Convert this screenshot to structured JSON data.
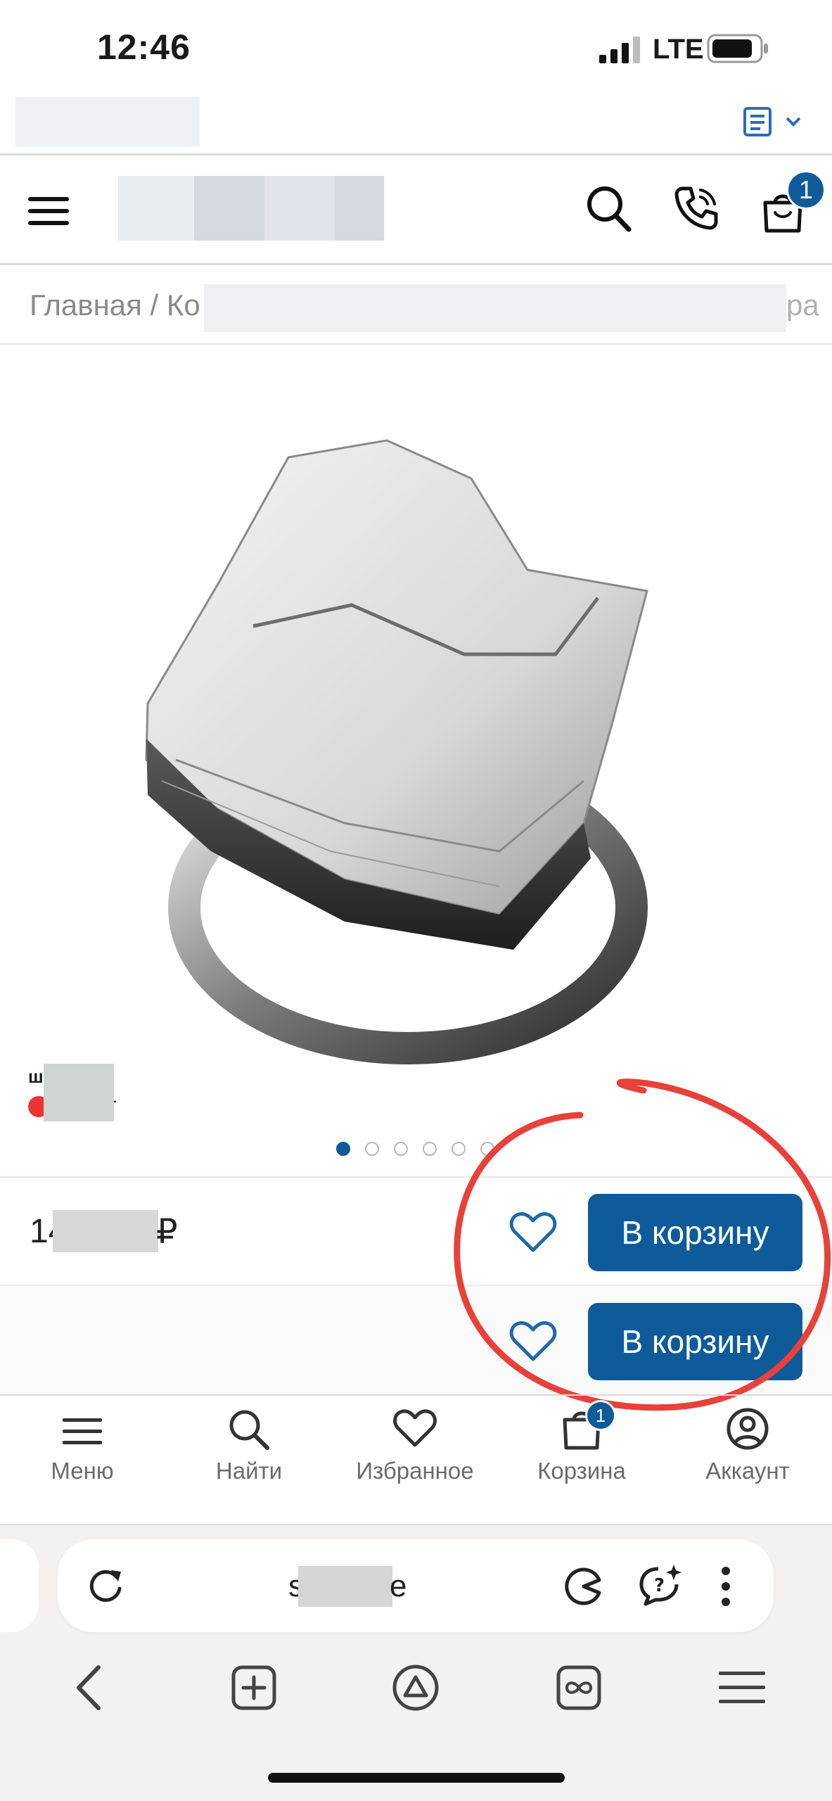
{
  "status_bar": {
    "time": "12:46",
    "network": "LTE"
  },
  "site_header": {
    "cart_count": "1"
  },
  "breadcrumb": {
    "text": "Главная / Ко",
    "tail": "ра"
  },
  "product": {
    "image_label_line1": "ш",
    "image_label_line2": "т",
    "price_prefix": "14",
    "price_suffix": "₽",
    "gallery_dots": 6,
    "gallery_active": 1
  },
  "actions": {
    "add_to_cart_label": "В корзину"
  },
  "bottom_nav": {
    "items": [
      {
        "label": "Меню"
      },
      {
        "label": "Найти"
      },
      {
        "label": "Избранное"
      },
      {
        "label": "Корзина"
      },
      {
        "label": "Аккаунт"
      }
    ],
    "cart_badge": "1"
  },
  "browser": {
    "url_start": "s",
    "url_end": "e"
  },
  "colors": {
    "accent": "#0f5b9a",
    "annotation": "#e8413a"
  }
}
